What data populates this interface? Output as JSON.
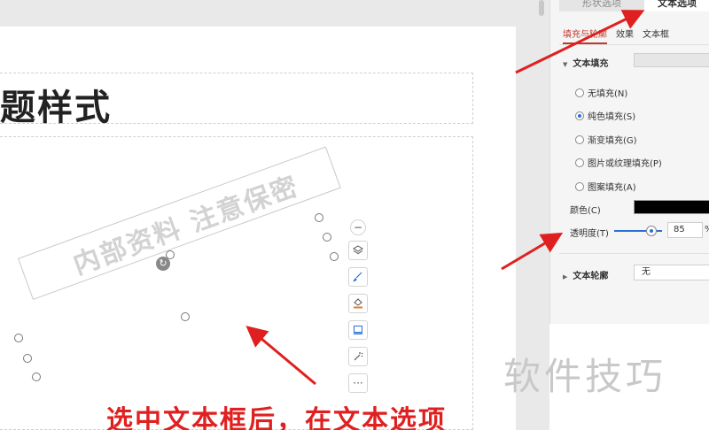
{
  "slide": {
    "title": "题样式",
    "watermark_text": "内部资料  注意保密"
  },
  "float_toolbar": {
    "buttons": [
      "collapse-icon",
      "layers-icon",
      "brush-icon",
      "fill-icon",
      "frame-icon",
      "magic-icon",
      "more-icon"
    ],
    "more_label": "···"
  },
  "panel": {
    "tabs": {
      "shape": "形状选项",
      "text": "文本选项"
    },
    "subtabs": {
      "fill_outline": "填充与轮廓",
      "effect": "效果",
      "textbox": "文本框"
    },
    "text_fill": {
      "title": "文本填充",
      "options": [
        "无填充(N)",
        "纯色填充(S)",
        "渐变填充(G)",
        "图片或纹理填充(P)",
        "图案填充(A)"
      ],
      "selected_index": 1,
      "color_label": "颜色(C)",
      "color_value": "#000000",
      "transparency_label": "透明度(T)",
      "transparency_value": "85",
      "transparency_unit": "%"
    },
    "text_outline": {
      "title": "文本轮廓",
      "value": "无"
    }
  },
  "annotation": {
    "caption": "选中文本框后，在文本选项",
    "corner_watermark": "软件技巧",
    "arrow_color": "#e02020"
  }
}
